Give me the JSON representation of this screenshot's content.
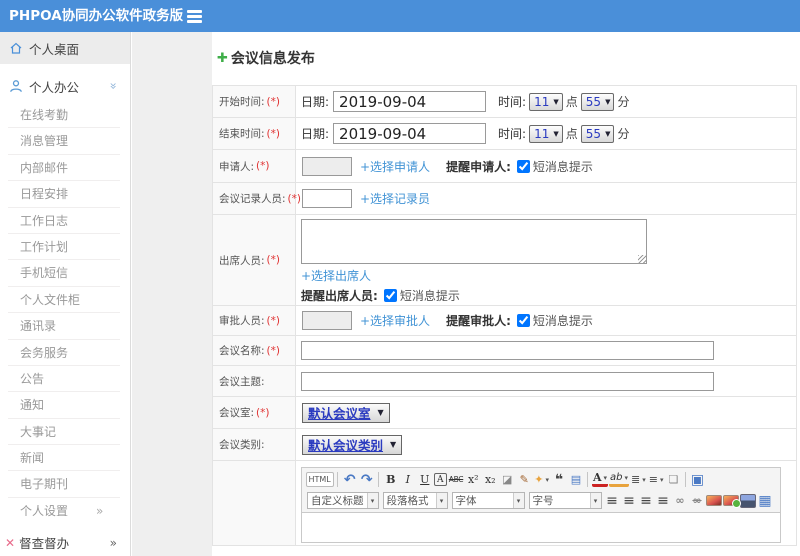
{
  "colors": {
    "header_bg": "#4a8fd9",
    "link": "#4193d5",
    "required": "#e03333",
    "select_text": "#2b3bc0",
    "plus_green": "#3fae49"
  },
  "header": {
    "app_title": "PHPOA协同办公软件政务版"
  },
  "sidebar": {
    "desktop": {
      "label": "个人桌面",
      "icon": "home-icon"
    },
    "office": {
      "label": "个人办公",
      "icon": "user-icon",
      "chevron": "chevron-double-down"
    },
    "sub_items": [
      "在线考勤",
      "消息管理",
      "内部邮件",
      "日程安排",
      "工作日志",
      "工作计划",
      "手机短信",
      "个人文件柜",
      "通讯录",
      "会务服务",
      "公告",
      "通知",
      "大事记",
      "新闻",
      "电子期刊"
    ],
    "settings": {
      "label": "个人设置",
      "chevron": "»"
    },
    "supervise": {
      "label": "督查督办",
      "icon": "supervise-icon",
      "chevron": "»"
    }
  },
  "page": {
    "title": "会议信息发布"
  },
  "form": {
    "required_mark": "(*)",
    "time_labels": {
      "date": "日期:",
      "time": "时间:",
      "hour_unit": "点",
      "minute_unit": "分"
    },
    "start_time": {
      "label": "开始时间:",
      "date": "2019-09-04",
      "hour": "11",
      "minute": "55"
    },
    "end_time": {
      "label": "结束时间:",
      "date": "2019-09-04",
      "hour": "11",
      "minute": "55"
    },
    "applicant": {
      "label": "申请人:",
      "value": "",
      "link": "+选择申请人",
      "remind": "提醒申请人:",
      "sms": "短消息提示",
      "checked": true
    },
    "recorder": {
      "label": "会议记录人员:",
      "value": "",
      "link": "+选择记录员"
    },
    "attendees": {
      "label": "出席人员:",
      "value": "",
      "link": "+选择出席人",
      "remind": "提醒出席人员:",
      "sms": "短消息提示",
      "checked": true
    },
    "approver": {
      "label": "审批人员:",
      "value": "",
      "link": "+选择审批人",
      "remind": "提醒审批人:",
      "sms": "短消息提示",
      "checked": true
    },
    "meeting_name": {
      "label": "会议名称:",
      "value": ""
    },
    "meeting_subject": {
      "label": "会议主题:",
      "value": ""
    },
    "meeting_room": {
      "label": "会议室:",
      "value": "默认会议室"
    },
    "meeting_category": {
      "label": "会议类别:",
      "value": "默认会议类别"
    }
  },
  "editor": {
    "toolbar_row1": [
      {
        "n": "html-source-button",
        "g": "HTML",
        "cls": "txtbtn"
      },
      {
        "n": "sep"
      },
      {
        "n": "undo-icon",
        "g": "↶",
        "cls": "c-blue bold big"
      },
      {
        "n": "redo-icon",
        "g": "↷",
        "cls": "c-blue bold big"
      },
      {
        "n": "sep"
      },
      {
        "n": "bold-icon",
        "g": "B",
        "cls": "bold serif"
      },
      {
        "n": "italic-icon",
        "g": "I",
        "cls": "italic serif"
      },
      {
        "n": "underline-icon",
        "g": "U",
        "cls": "underline serif"
      },
      {
        "n": "font-border-icon",
        "g": "A",
        "cls": "boxed serif"
      },
      {
        "n": "strikethrough-icon",
        "g": "ABC",
        "cls": "strike"
      },
      {
        "n": "superscript-icon",
        "g": "x²",
        "cls": "serif"
      },
      {
        "n": "subscript-icon",
        "g": "x₂",
        "cls": "serif"
      },
      {
        "n": "eraser-icon",
        "g": "◪",
        "cls": "c-gray"
      },
      {
        "n": "format-brush-icon",
        "g": "✎",
        "cls": "c-brown"
      },
      {
        "n": "color-wand-icon",
        "g": "✦",
        "cls": "c-orange",
        "dd": true
      },
      {
        "n": "blockquote-icon",
        "g": "❝",
        "cls": "bold c-dark big"
      },
      {
        "n": "paste-icon",
        "g": "▤",
        "cls": "c-blue"
      },
      {
        "n": "sep"
      },
      {
        "n": "font-color-icon",
        "g": "A",
        "cls": "fontcolor serif bold",
        "dd": true
      },
      {
        "n": "highlight-icon",
        "g": "ab",
        "cls": "hl italic",
        "dd": true
      },
      {
        "n": "ordered-list-icon",
        "g": "≣",
        "cls": "c-dark",
        "dd": true
      },
      {
        "n": "unordered-list-icon",
        "g": "≡",
        "cls": "c-dark",
        "dd": true
      },
      {
        "n": "new-page-icon",
        "g": "❏",
        "cls": "c-gray"
      },
      {
        "n": "sep"
      },
      {
        "n": "fullscreen-icon",
        "g": "▣",
        "cls": "c-blue big"
      }
    ],
    "toolbar_row2_selects": [
      {
        "n": "custom-style-select",
        "label": "自定义标题",
        "w": 54
      },
      {
        "n": "paragraph-format-select",
        "label": "段落格式",
        "w": 52
      },
      {
        "n": "font-family-select",
        "label": "字体",
        "w": 60
      },
      {
        "n": "font-size-select",
        "label": "字号",
        "w": 60
      }
    ],
    "toolbar_row2_icons": [
      {
        "n": "align-left-icon",
        "g": "≡",
        "cls": "c-dark big"
      },
      {
        "n": "align-center-icon",
        "g": "≡",
        "cls": "c-dark big"
      },
      {
        "n": "align-right-icon",
        "g": "≡",
        "cls": "c-dark big"
      },
      {
        "n": "align-justify-icon",
        "g": "≡",
        "cls": "c-dark big"
      },
      {
        "n": "link-icon",
        "g": "∞",
        "cls": "c-gray bold"
      },
      {
        "n": "unlink-icon",
        "g": "∞",
        "cls": "c-gray bold broken"
      },
      {
        "n": "image-icon",
        "cls": "img-swatch"
      },
      {
        "n": "image-add-icon",
        "cls": "img-swatch plus"
      },
      {
        "n": "media-icon",
        "cls": "media-swatch"
      },
      {
        "n": "table-icon",
        "g": "▦",
        "cls": "c-blue big"
      }
    ]
  }
}
